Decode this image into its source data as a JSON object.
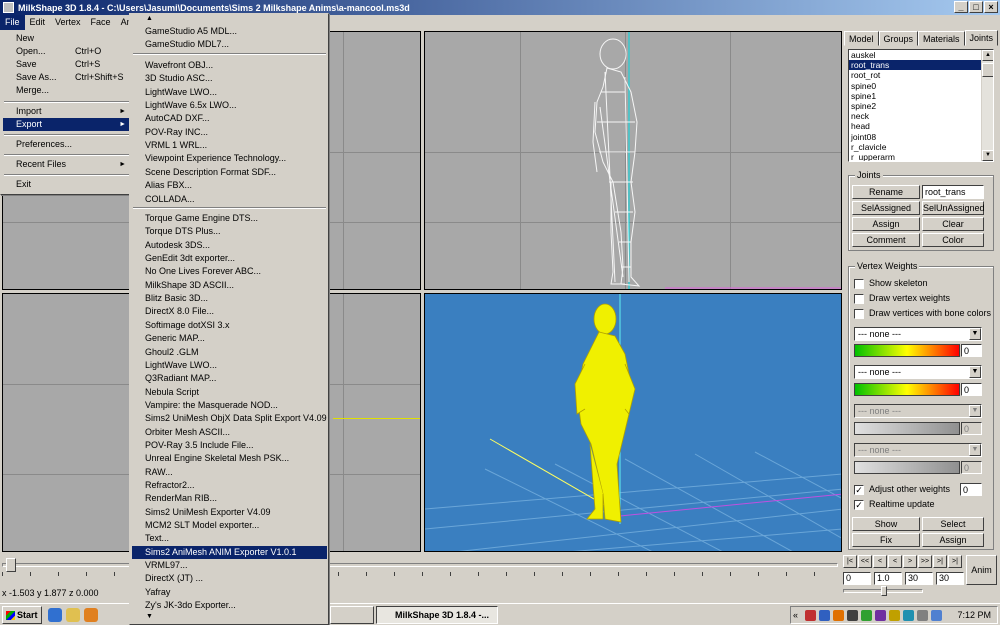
{
  "window": {
    "title": "MilkShape 3D 1.8.4 - C:\\Users\\Jasumi\\Documents\\Sims 2 Milkshape Anims\\a-mancool.ms3d",
    "min_label": "_",
    "max_label": "□",
    "close_label": "×"
  },
  "menubar": {
    "items": [
      "File",
      "Edit",
      "Vertex",
      "Face",
      "Anim"
    ]
  },
  "file_menu": {
    "new": "New",
    "open": "Open...",
    "open_sc": "Ctrl+O",
    "save": "Save",
    "save_sc": "Ctrl+S",
    "saveas": "Save As...",
    "saveas_sc": "Ctrl+Shift+S",
    "merge": "Merge...",
    "import": "Import",
    "export": "Export",
    "preferences": "Preferences...",
    "recent": "Recent Files",
    "exit": "Exit",
    "submenu_arrow": "►"
  },
  "export_menu": {
    "scroll_up": "▲",
    "scroll_down": "▼",
    "group1": [
      "GameStudio A5 MDL...",
      "GameStudio MDL7..."
    ],
    "group2": [
      "Wavefront OBJ...",
      "3D Studio ASC...",
      "LightWave LWO...",
      "LightWave 6.5x LWO...",
      "AutoCAD DXF...",
      "POV-Ray INC...",
      "VRML 1 WRL...",
      "Viewpoint Experience Technology...",
      "Scene Description Format SDF...",
      "Alias FBX...",
      "COLLADA..."
    ],
    "group3": [
      "Torque Game Engine DTS...",
      "Torque DTS Plus...",
      "Autodesk 3DS...",
      "GenEdit 3dt exporter...",
      "No One Lives Forever ABC...",
      "MilkShape 3D ASCII...",
      "Blitz Basic 3D...",
      "DirectX 8.0 File...",
      "Softimage dotXSI 3.x",
      "Generic MAP...",
      "Ghoul2 .GLM",
      "LightWave LWO...",
      "Q3Radiant MAP...",
      "Nebula Script",
      "Vampire: the Masquerade NOD...",
      "Sims2 UniMesh ObjX Data Split Export V4.09",
      "Orbiter Mesh ASCII...",
      "POV-Ray 3.5 Include File...",
      "Unreal Engine Skeletal Mesh PSK...",
      "RAW...",
      "Refractor2...",
      "RenderMan RIB...",
      "Sims2 UniMesh Exporter V4.09",
      "MCM2 SLT Model exporter...",
      "Text...",
      "Sims2 AniMesh ANIM Exporter V1.0.1",
      "VRML97...",
      "DirectX (JT) ...",
      "Yafray",
      "Zy's JK-3do Exporter..."
    ]
  },
  "panel": {
    "tabs": [
      "Model",
      "Groups",
      "Materials",
      "Joints"
    ],
    "joints_list": [
      "auskel",
      "root_trans",
      "root_rot",
      "spine0",
      "spine1",
      "spine2",
      "neck",
      "head",
      "joint08",
      "r_clavicle",
      "r_upperarm"
    ],
    "selected_joint": "root_trans",
    "joints_group": "Joints",
    "rename": "Rename",
    "name_value": "root_trans",
    "selassigned": "SelAssigned",
    "selunassigned": "SelUnAssigned",
    "assign": "Assign",
    "clear": "Clear",
    "comment": "Comment",
    "color": "Color",
    "vw_group": "Vertex Weights",
    "show_skeleton": "Show skeleton",
    "draw_vertex_weights": "Draw vertex weights",
    "draw_vertices_bone": "Draw vertices with bone colors",
    "none": "--- none ---",
    "weight_value": "0",
    "adjust_other": "Adjust other weights",
    "realtime": "Realtime update",
    "check_mark": "✓",
    "show": "Show",
    "select": "Select",
    "fix": "Fix",
    "assign2": "Assign"
  },
  "status": {
    "coords": "x -1.503 y 1.877 z 0.000"
  },
  "anim": {
    "buttons": [
      "|<",
      "<<",
      "<",
      "<",
      ">",
      ">>",
      ">|",
      ">|"
    ],
    "anim_label": "Anim",
    "fields": [
      "0",
      "1.0",
      "30",
      "30"
    ]
  },
  "taskbar": {
    "start": "Start",
    "task1": "",
    "task2": "MilkShape 3D 1.8.4 -...",
    "clock": "7:12 PM"
  }
}
